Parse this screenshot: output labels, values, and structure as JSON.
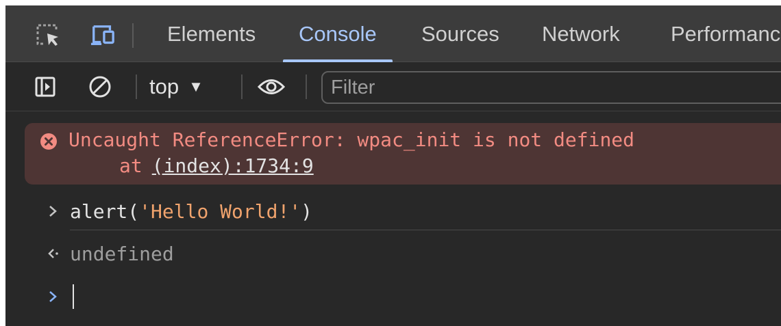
{
  "tabs": [
    {
      "label": "Elements",
      "active": false
    },
    {
      "label": "Console",
      "active": true
    },
    {
      "label": "Sources",
      "active": false
    },
    {
      "label": "Network",
      "active": false
    },
    {
      "label": "Performanc",
      "active": false
    }
  ],
  "toolbar": {
    "context": "top",
    "filter_placeholder": "Filter"
  },
  "console": {
    "error": {
      "message": "Uncaught ReferenceError: wpac_init is not defined",
      "at_label": "at",
      "location": "(index):1734:9"
    },
    "input": {
      "func": "alert(",
      "arg": "'Hello World!'",
      "close": ")"
    },
    "result": "undefined"
  },
  "colors": {
    "accent": "#a8c7fa",
    "error_text": "#f28b82",
    "error_bg": "#4e3534",
    "string": "#f0a36d",
    "panel_bg": "#282828",
    "tabbar_bg": "#3c3c3c"
  },
  "icons": [
    "inspect-element-icon",
    "device-toolbar-icon",
    "sidebar-toggle-icon",
    "clear-console-icon",
    "eye-icon",
    "error-icon",
    "chevron-right-icon",
    "return-arrow-icon"
  ]
}
